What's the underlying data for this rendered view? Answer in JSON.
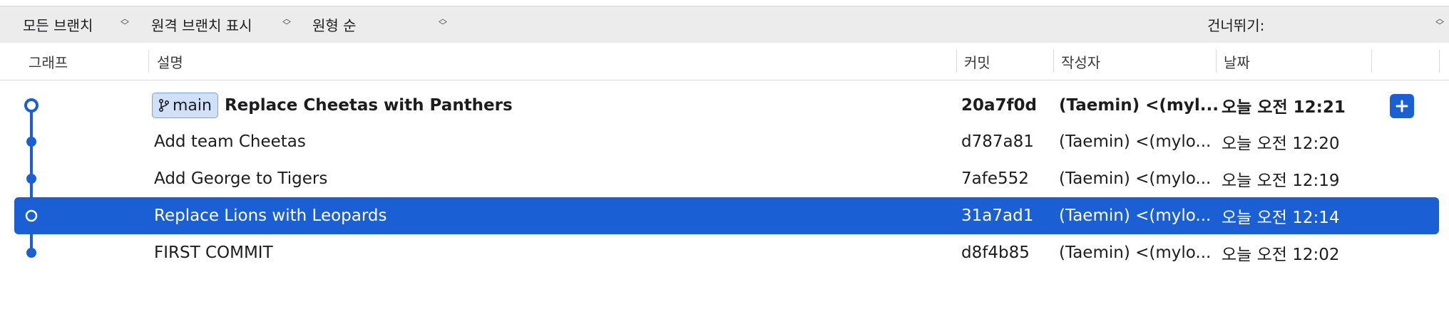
{
  "filters": {
    "branches": "모든 브랜치",
    "remote": "원격 브랜치 표시",
    "order": "원형 순",
    "skip": "건너뛰기:"
  },
  "columns": {
    "graph": "그래프",
    "description": "설명",
    "commit": "커밋",
    "author": "작성자",
    "date": "날짜"
  },
  "commits": [
    {
      "branch": "main",
      "description": "Replace Cheetas with Panthers",
      "hash": "20a7f0d",
      "author": "(Taemin) <(myl...",
      "date": "오늘 오전 12:21",
      "head": true,
      "selected": false
    },
    {
      "description": "Add team Cheetas",
      "hash": "d787a81",
      "author": "(Taemin) <(mylo...",
      "date": "오늘 오전 12:20",
      "head": false,
      "selected": false
    },
    {
      "description": "Add George to Tigers",
      "hash": "7afe552",
      "author": "(Taemin) <(mylo...",
      "date": "오늘 오전 12:19",
      "head": false,
      "selected": false
    },
    {
      "description": "Replace Lions with Leopards",
      "hash": "31a7ad1",
      "author": "(Taemin) <(mylo...",
      "date": "오늘 오전 12:14",
      "head": false,
      "selected": true
    },
    {
      "description": "FIRST COMMIT",
      "hash": "d8f4b85",
      "author": "(Taemin) <(mylo...",
      "date": "오늘 오전 12:02",
      "head": false,
      "selected": false
    }
  ],
  "colors": {
    "accent": "#1a5fd3",
    "badge_bg": "#cfe0f8"
  },
  "icons": {
    "branch": "branch-icon",
    "add": "plus-icon",
    "sort": "updown-chevron-icon"
  }
}
